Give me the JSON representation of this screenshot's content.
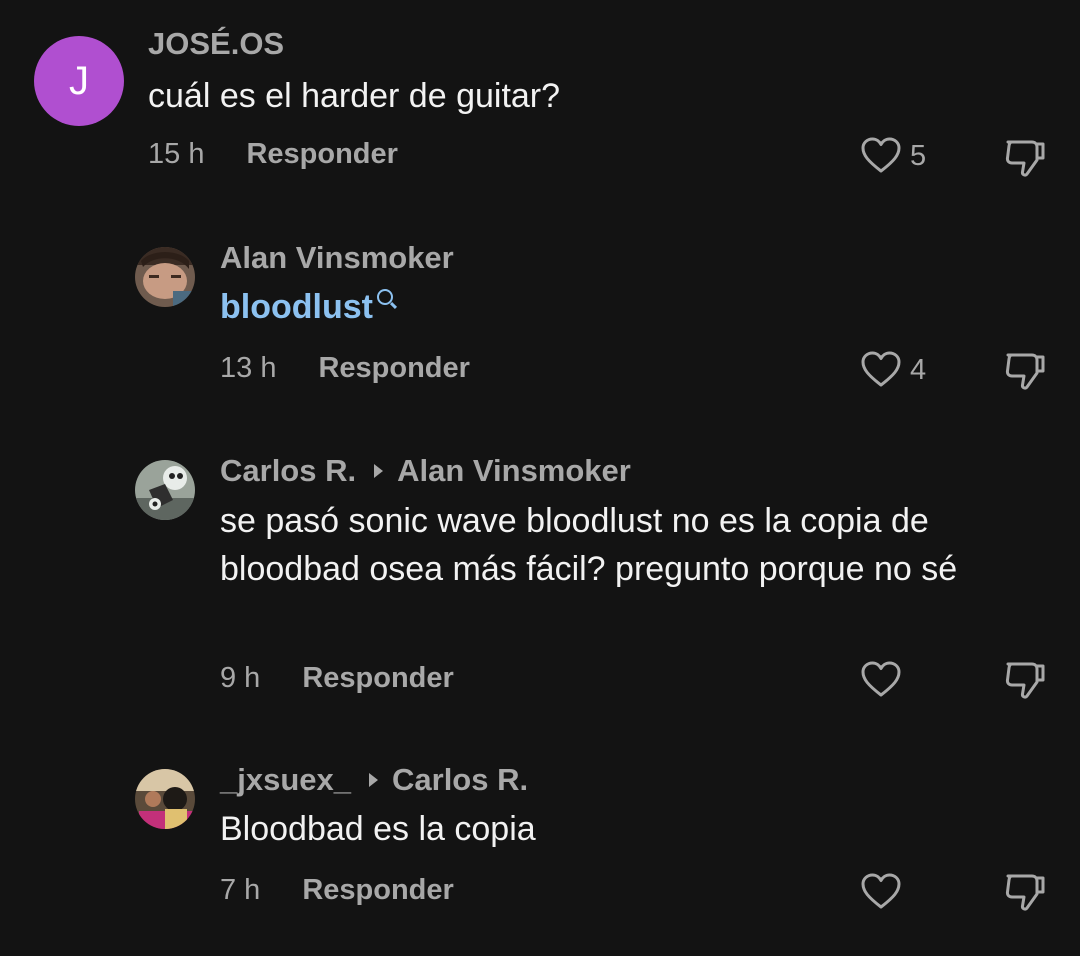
{
  "comments": [
    {
      "avatar_letter": "J",
      "avatar_color": "#b04fd0",
      "username": "JOSÉ.OS",
      "text": "cuál es el harder de guitar?",
      "time": "15 h",
      "reply_label": "Responder",
      "likes": "5"
    },
    {
      "username": "Alan Vinsmoker",
      "text": "bloodlust",
      "text_is_search_link": true,
      "time": "13 h",
      "reply_label": "Responder",
      "likes": "4"
    },
    {
      "username": "Carlos R.",
      "reply_to": "Alan Vinsmoker",
      "text": "se pasó sonic wave bloodlust no es la copia de bloodbad osea más fácil? pregunto porque no sé",
      "time": "9 h",
      "reply_label": "Responder",
      "likes": ""
    },
    {
      "username": "_jxsuex_",
      "reply_to": "Carlos R.",
      "text": "Bloodbad es la copia",
      "time": "7 h",
      "reply_label": "Responder",
      "likes": ""
    }
  ],
  "icons": {
    "like": "heart-outline-icon",
    "dislike": "thumbs-down-icon",
    "search": "search-icon",
    "reply_caret": "caret-right-icon"
  },
  "colors": {
    "background": "#131313",
    "muted_text": "#a8a8a8",
    "link": "#8cc1f0"
  }
}
